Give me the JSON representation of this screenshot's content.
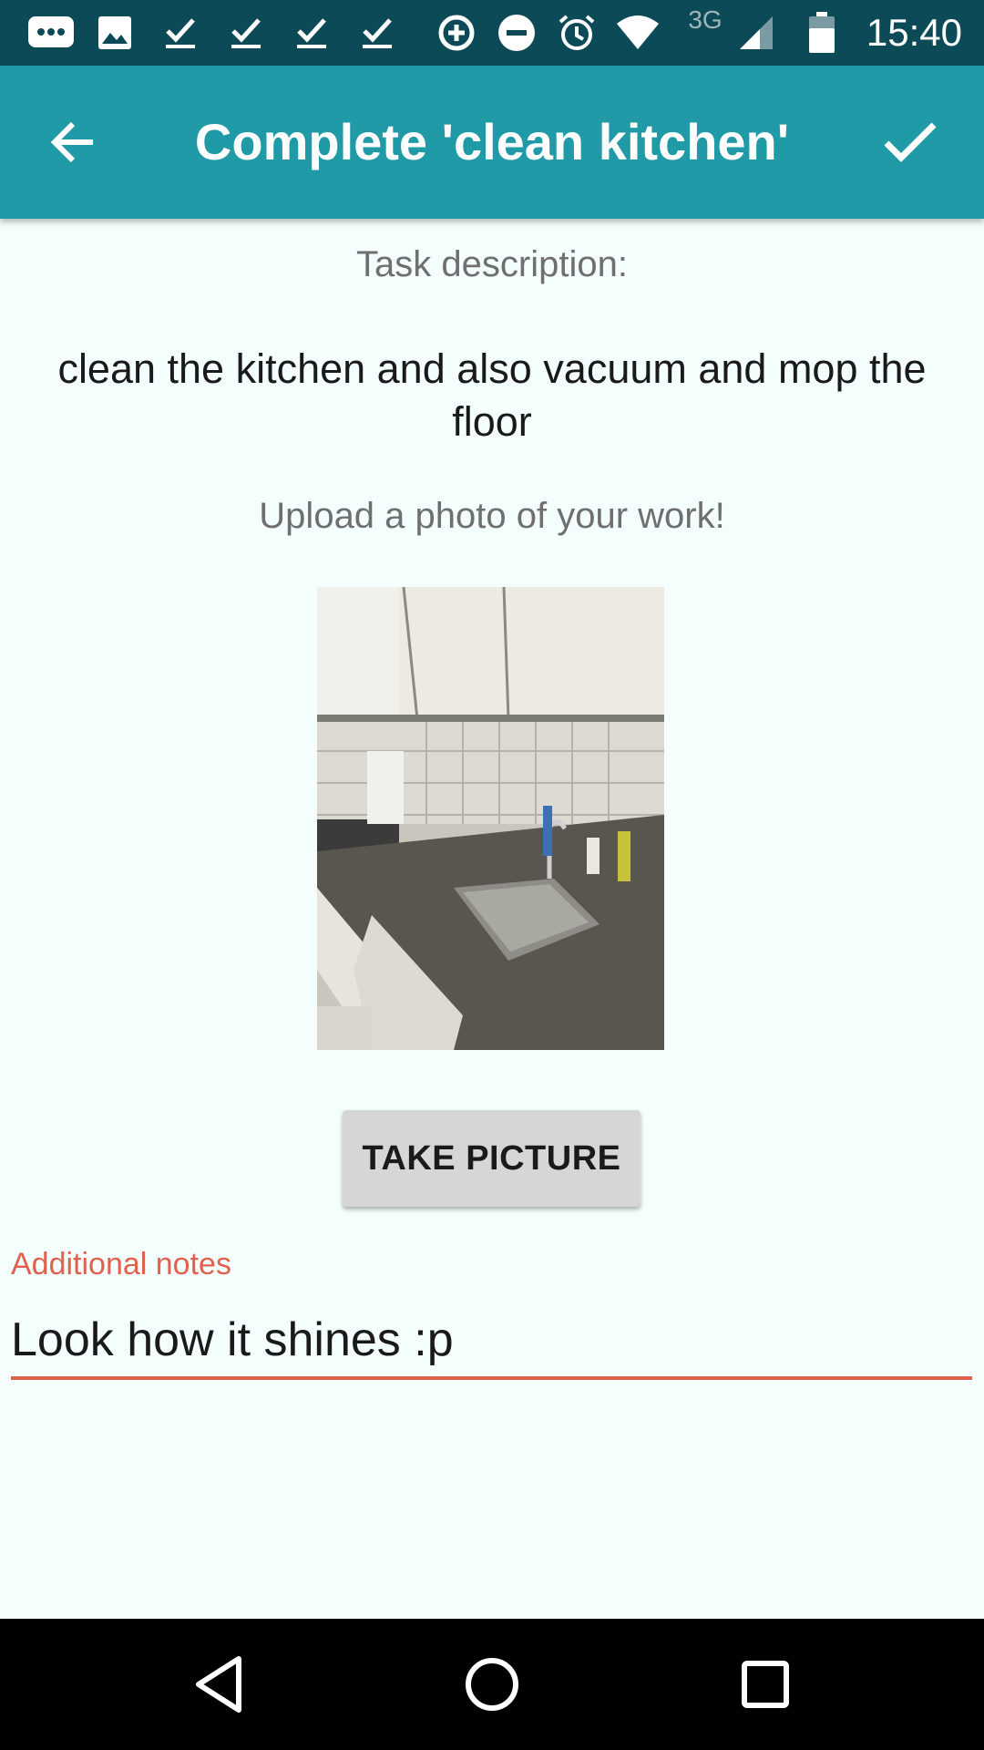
{
  "status_bar": {
    "time": "15:40",
    "network": "3G",
    "icons": [
      "messages-icon",
      "image-icon",
      "check-icon",
      "check-icon",
      "check-icon",
      "check-icon",
      "data-saver-icon",
      "do-not-disturb-icon",
      "alarm-icon",
      "wifi-icon",
      "cell-signal-icon",
      "battery-icon"
    ]
  },
  "app_bar": {
    "title": "Complete 'clean kitchen'",
    "back_icon": "arrow-back-icon",
    "confirm_icon": "check-icon",
    "color": "#1f9aa6"
  },
  "content": {
    "description_label": "Task description:",
    "description": "clean the kitchen and also vacuum and mop the floor",
    "upload_prompt": "Upload a photo of your work!",
    "take_picture_label": "TAKE PICTURE",
    "notes_label": "Additional notes",
    "notes_value": "Look how it shines :p",
    "accent_color": "#e0614e"
  },
  "nav_bar": {
    "icons": [
      "back-triangle-icon",
      "home-circle-icon",
      "recents-square-icon"
    ]
  }
}
